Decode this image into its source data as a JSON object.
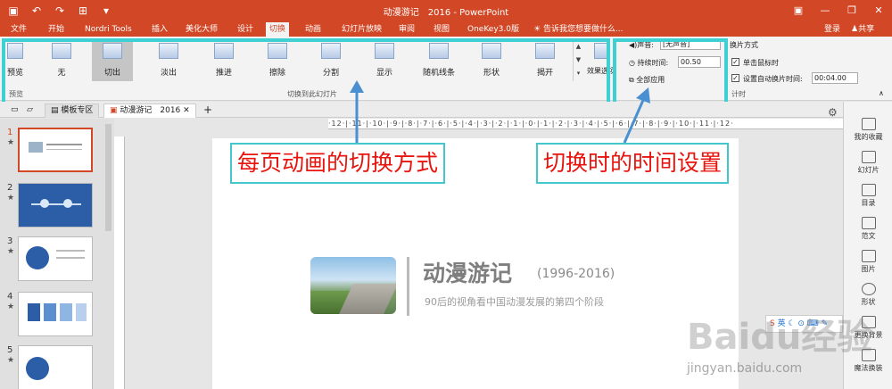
{
  "titlebar": {
    "title": "动漫游记　2016 - PowerPoint"
  },
  "tabs": [
    "文件",
    "开始",
    "Nordri Tools",
    "插入",
    "美化大师",
    "设计",
    "切换",
    "动画",
    "幻灯片放映",
    "审阅",
    "视图",
    "OneKey3.0版"
  ],
  "tell_me": "告诉我您想要做什么...",
  "signin": "登录",
  "share": "共享",
  "ribbon": {
    "preview": "预览",
    "transitions": [
      "无",
      "切出",
      "淡出",
      "推进",
      "擦除",
      "分割",
      "显示",
      "随机线条",
      "形状",
      "揭开"
    ],
    "effect_options": "效果选项",
    "group_label": "切换到此幻灯片",
    "sound_label": "声音:",
    "sound_value": "[无声音]",
    "duration_label": "持续时间:",
    "duration_value": "00.50",
    "apply_all": "全部应用",
    "advance_label": "换片方式",
    "on_click": "单击鼠标时",
    "after_label": "设置自动换片时间:",
    "after_value": "00:04.00",
    "timing_label": "计时"
  },
  "doc_tabs": [
    "模板专区",
    "动漫游记　2016"
  ],
  "thumbnails": [
    {
      "num": "1",
      "selected": true
    },
    {
      "num": "2"
    },
    {
      "num": "3"
    },
    {
      "num": "4"
    },
    {
      "num": "5"
    }
  ],
  "ruler_text": "·12·|·11·|·10·|·9·|·8·|·7·|·6·|·5·|·4·|·3·|·2·|·1·|·0·|·1·|·2·|·3·|·4·|·5·|·6·|·7·|·8·|·9·|·10·|·11·|·12·",
  "slide": {
    "title": "动漫游记",
    "years": "(1996-2016)",
    "subtitle": "90后的视角看中国动漫发展的第四个阶段"
  },
  "annotations": {
    "left": "每页动画的切换方式",
    "right": "切换时的时间设置"
  },
  "right_panel": [
    "我的收藏",
    "幻灯片",
    "目录",
    "范文",
    "图片",
    "形状",
    "更换背景",
    "魔法换装"
  ],
  "watermark": "Baidu经验",
  "watermark_url": "jingyan.baidu.com",
  "ime_label": "英",
  "highlight_color": "#3fd0d4",
  "accent": "#d24726"
}
